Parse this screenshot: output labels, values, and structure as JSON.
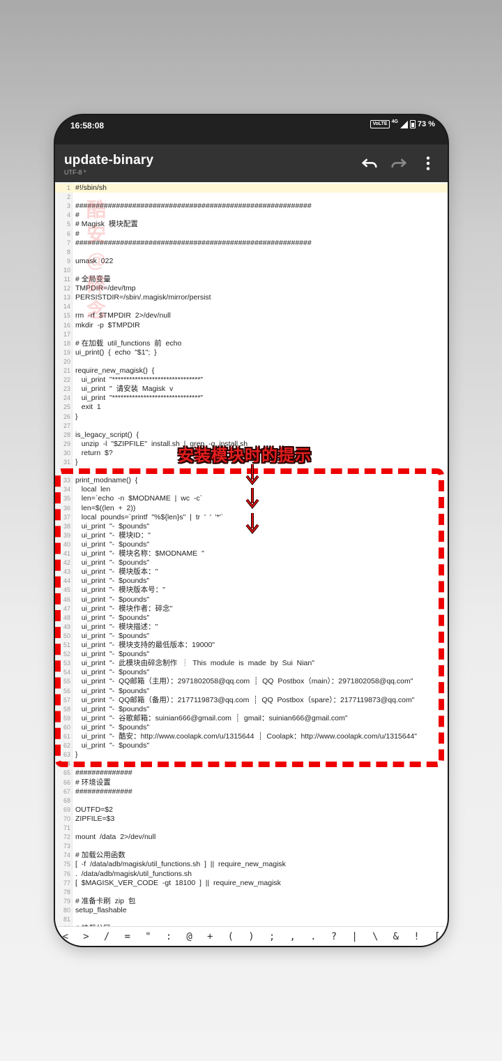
{
  "status": {
    "time": "16:58:08",
    "volte": "VoLTE",
    "network": "4G",
    "battery": "73 %"
  },
  "toolbar": {
    "title": "update-binary",
    "subtitle": "UTF-8 *",
    "icons": [
      "undo-icon",
      "redo-icon",
      "more-icon"
    ]
  },
  "annotation": {
    "text": "安装模块时的提示"
  },
  "watermark": {
    "text": "酷安@碎念"
  },
  "editor": {
    "lines": [
      {
        "n": "1",
        "t": "#!/sbin/sh"
      },
      {
        "n": "2",
        "t": ""
      },
      {
        "n": "3",
        "t": "##########################################################"
      },
      {
        "n": "4",
        "t": "#"
      },
      {
        "n": "5",
        "t": "# Magisk  模块配置"
      },
      {
        "n": "6",
        "t": "#"
      },
      {
        "n": "7",
        "t": "##########################################################"
      },
      {
        "n": "8",
        "t": ""
      },
      {
        "n": "9",
        "t": "umask  022"
      },
      {
        "n": "10",
        "t": ""
      },
      {
        "n": "11",
        "t": "# 全局变量"
      },
      {
        "n": "12",
        "t": "TMPDIR=/dev/tmp"
      },
      {
        "n": "13",
        "t": "PERSISTDIR=/sbin/.magisk/mirror/persist"
      },
      {
        "n": "14",
        "t": ""
      },
      {
        "n": "15",
        "t": "rm  -rf  $TMPDIR  2>/dev/null"
      },
      {
        "n": "16",
        "t": "mkdir  -p  $TMPDIR"
      },
      {
        "n": "17",
        "t": ""
      },
      {
        "n": "18",
        "t": "# 在加载  util_functions  前  echo"
      },
      {
        "n": "19",
        "t": "ui_print()  {  echo  \"$1\";  }"
      },
      {
        "n": "20",
        "t": ""
      },
      {
        "n": "21",
        "t": "require_new_magisk()  {"
      },
      {
        "n": "22",
        "t": "   ui_print  \"*******************************\""
      },
      {
        "n": "23",
        "t": "   ui_print  \"  请安装  Magisk  v"
      },
      {
        "n": "24",
        "t": "   ui_print  \"*******************************\""
      },
      {
        "n": "25",
        "t": "   exit  1"
      },
      {
        "n": "26",
        "t": "}"
      },
      {
        "n": "27",
        "t": ""
      },
      {
        "n": "28",
        "t": "is_legacy_script()  {"
      },
      {
        "n": "29",
        "t": "   unzip  -l  \"$ZIPFILE\"  install.sh  |  grep  -q  install.sh"
      },
      {
        "n": "30",
        "t": "   return  $?"
      },
      {
        "n": "31",
        "t": "}"
      },
      {
        "n": "32",
        "t": ""
      },
      {
        "n": "33",
        "t": "print_modname()  {"
      },
      {
        "n": "34",
        "t": "   local  len"
      },
      {
        "n": "35",
        "t": "   len=`echo  -n  $MODNAME  |  wc  -c`"
      },
      {
        "n": "36",
        "t": "   len=$((len  +  2))"
      },
      {
        "n": "37",
        "t": "   local  pounds=`printf  \"%${len}s\"  |  tr  '  '  '*'`"
      },
      {
        "n": "38",
        "t": "   ui_print  \"-  $pounds\""
      },
      {
        "n": "39",
        "t": "   ui_print  \"-  模块ID：\""
      },
      {
        "n": "40",
        "t": "   ui_print  \"-  $pounds\""
      },
      {
        "n": "41",
        "t": "   ui_print  \"-  模块名称：$MODNAME  \""
      },
      {
        "n": "42",
        "t": "   ui_print  \"-  $pounds\""
      },
      {
        "n": "43",
        "t": "   ui_print  \"-  模块版本：\""
      },
      {
        "n": "44",
        "t": "   ui_print  \"-  $pounds\""
      },
      {
        "n": "45",
        "t": "   ui_print  \"-  模块版本号：\""
      },
      {
        "n": "46",
        "t": "   ui_print  \"-  $pounds\""
      },
      {
        "n": "47",
        "t": "   ui_print  \"-  模块作者：碎念\""
      },
      {
        "n": "48",
        "t": "   ui_print  \"-  $pounds\""
      },
      {
        "n": "49",
        "t": "   ui_print  \"-  模块描述：\""
      },
      {
        "n": "50",
        "t": "   ui_print  \"-  $pounds\""
      },
      {
        "n": "51",
        "t": "   ui_print  \"-  模块支持的最低版本：19000\""
      },
      {
        "n": "52",
        "t": "   ui_print  \"-  $pounds\""
      },
      {
        "n": "53",
        "t": "   ui_print  \"-  此模块由碎念制作  ┊  This  module  is  made  by  Sui  Nian\""
      },
      {
        "n": "54",
        "t": "   ui_print  \"-  $pounds\""
      },
      {
        "n": "55",
        "t": "   ui_print  \"-  QQ邮箱（主用）：2971802058@qq.com  ┊  QQ  Postbox（main）：2971802058@qq.com\""
      },
      {
        "n": "56",
        "t": "   ui_print  \"-  $pounds\""
      },
      {
        "n": "57",
        "t": "   ui_print  \"-  QQ邮箱（备用）：2177119873@qq.com  ┊  QQ  Postbox（spare）：2177119873@qq.com\""
      },
      {
        "n": "58",
        "t": "   ui_print  \"-  $pounds\""
      },
      {
        "n": "59",
        "t": "   ui_print  \"-  谷歌邮箱：suinian666@gmail.com  ┊  gmail：suinian666@gmail.com\""
      },
      {
        "n": "60",
        "t": "   ui_print  \"-  $pounds\""
      },
      {
        "n": "61",
        "t": "   ui_print  \"-  酷安：http://www.coolapk.com/u/1315644  ┊  Coolapk：http://www.coolapk.com/u/1315644\""
      },
      {
        "n": "62",
        "t": "   ui_print  \"-  $pounds\""
      },
      {
        "n": "63",
        "t": "}"
      },
      {
        "n": "64",
        "t": ""
      },
      {
        "n": "65",
        "t": "##############"
      },
      {
        "n": "66",
        "t": "# 环境设置"
      },
      {
        "n": "67",
        "t": "##############"
      },
      {
        "n": "68",
        "t": ""
      },
      {
        "n": "69",
        "t": "OUTFD=$2"
      },
      {
        "n": "70",
        "t": "ZIPFILE=$3"
      },
      {
        "n": "71",
        "t": ""
      },
      {
        "n": "72",
        "t": "mount  /data  2>/dev/null"
      },
      {
        "n": "73",
        "t": ""
      },
      {
        "n": "74",
        "t": "# 加载公用函数"
      },
      {
        "n": "75",
        "t": "[  -f  /data/adb/magisk/util_functions.sh  ]  ||  require_new_magisk"
      },
      {
        "n": "76",
        "t": ".  /data/adb/magisk/util_functions.sh"
      },
      {
        "n": "77",
        "t": "[  $MAGISK_VER_CODE  -gt  18100  ]  ||  require_new_magisk"
      },
      {
        "n": "78",
        "t": ""
      },
      {
        "n": "79",
        "t": "# 准备卡刷  zip  包"
      },
      {
        "n": "80",
        "t": "setup_flashable"
      },
      {
        "n": "81",
        "t": ""
      },
      {
        "n": "82",
        "t": "# 挂载分区"
      }
    ]
  },
  "symbols": [
    "<",
    ">",
    "/",
    "=",
    "\"",
    ":",
    "@",
    "+",
    "(",
    ")",
    ";",
    ",",
    ".",
    "?",
    "|",
    "\\",
    "&",
    "!",
    "["
  ]
}
